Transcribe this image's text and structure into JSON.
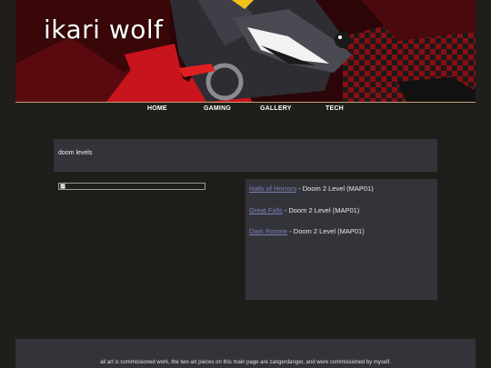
{
  "site": {
    "title": "ikari wolf"
  },
  "nav": [
    {
      "label": "HOME"
    },
    {
      "label": "GAMING"
    },
    {
      "label": "GALLERY"
    },
    {
      "label": "TECH"
    }
  ],
  "page": {
    "heading": "doom levels"
  },
  "levels": [
    {
      "name": "Halls of Horrors",
      "desc": " - Doom 2 Level (MAP01)"
    },
    {
      "name": "Great Falls",
      "desc": " - Doom 2 Level (MAP01)"
    },
    {
      "name": "Dark Roome",
      "desc": " - Doom 2 Level (MAP01)"
    }
  ],
  "footer": {
    "text": "all art is commissioned work, the two art pieces on this main page are zangerdanger, and were commissioned by myself."
  },
  "colors": {
    "background": "#1f1e1b",
    "panel": "#33343a",
    "link": "#7d7fb8",
    "accent": "#c8a070",
    "banner_red": "#c8141c"
  }
}
